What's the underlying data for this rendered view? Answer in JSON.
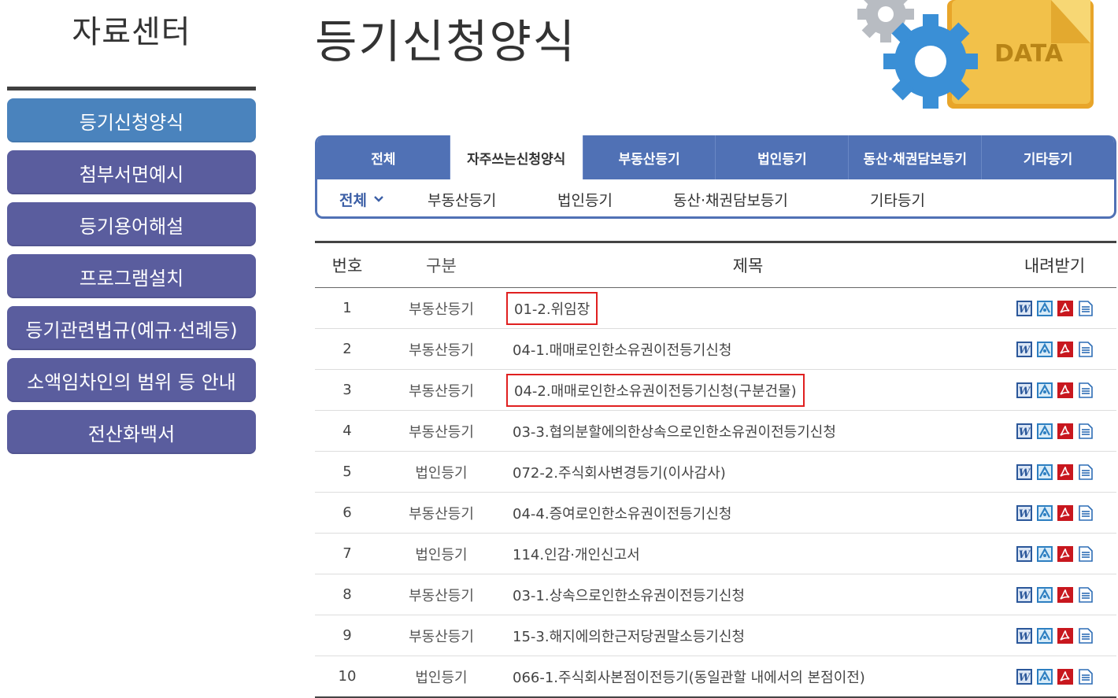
{
  "sidebar": {
    "title": "자료센터",
    "items": [
      {
        "label": "등기신청양식",
        "active": true
      },
      {
        "label": "첨부서면예시",
        "active": false
      },
      {
        "label": "등기용어해설",
        "active": false
      },
      {
        "label": "프로그램설치",
        "active": false
      },
      {
        "label": "등기관련법규(예규·선례등)",
        "active": false
      },
      {
        "label": "소액임차인의 범위 등 안내",
        "active": false
      },
      {
        "label": "전산화백서",
        "active": false
      }
    ]
  },
  "header": {
    "title": "등기신청양식",
    "hero_label": "DATA"
  },
  "tabs": [
    {
      "label": "전체"
    },
    {
      "label": "자주쓰는신청양식"
    },
    {
      "label": "부동산등기"
    },
    {
      "label": "법인등기"
    },
    {
      "label": "동산·채권담보등기"
    },
    {
      "label": "기타등기"
    }
  ],
  "subtabs": [
    {
      "label": "전체"
    },
    {
      "label": "부동산등기"
    },
    {
      "label": "법인등기"
    },
    {
      "label": "동산·채권담보등기"
    },
    {
      "label": "기타등기"
    }
  ],
  "table": {
    "headers": {
      "no": "번호",
      "category": "구분",
      "title": "제목",
      "download": "내려받기"
    },
    "rows": [
      {
        "no": "1",
        "category": "부동산등기",
        "title": "01-2.위임장"
      },
      {
        "no": "2",
        "category": "부동산등기",
        "title": "04-1.매매로인한소유권이전등기신청"
      },
      {
        "no": "3",
        "category": "부동산등기",
        "title": "04-2.매매로인한소유권이전등기신청(구분건물)"
      },
      {
        "no": "4",
        "category": "부동산등기",
        "title": "03-3.협의분할에의한상속으로인한소유권이전등기신청"
      },
      {
        "no": "5",
        "category": "법인등기",
        "title": "072-2.주식회사변경등기(이사감사)"
      },
      {
        "no": "6",
        "category": "부동산등기",
        "title": "04-4.증여로인한소유권이전등기신청"
      },
      {
        "no": "7",
        "category": "법인등기",
        "title": "114.인감·개인신고서"
      },
      {
        "no": "8",
        "category": "부동산등기",
        "title": "03-1.상속으로인한소유권이전등기신청"
      },
      {
        "no": "9",
        "category": "부동산등기",
        "title": "15-3.해지에의한근저당권말소등기신청"
      },
      {
        "no": "10",
        "category": "법인등기",
        "title": "066-1.주식회사본점이전등기(동일관할 내에서의 본점이전)"
      }
    ],
    "download_icons": [
      "word-icon",
      "hwp-icon",
      "pdf-icon",
      "text-file-icon"
    ]
  },
  "colors": {
    "sidebar_item": "#5a5d9e",
    "sidebar_active": "#4a83bd",
    "tab_bar": "#5071b5",
    "highlight": "#e02020"
  }
}
